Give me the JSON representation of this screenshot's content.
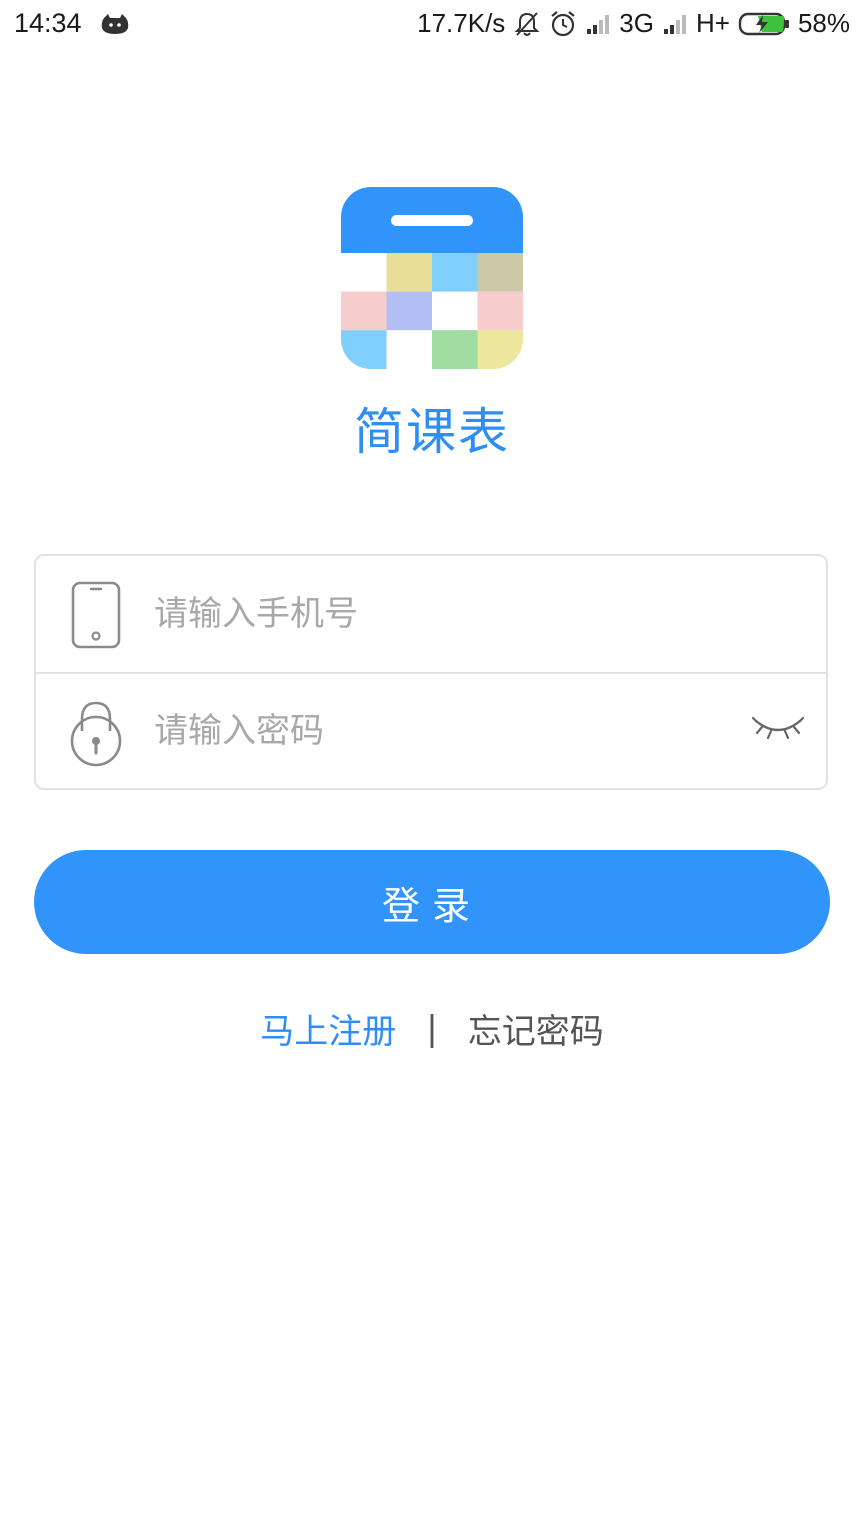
{
  "status_bar": {
    "time": "14:34",
    "network_speed": "17.7K/s",
    "network_3g": "3G",
    "network_hplus": "H+",
    "battery": "58%",
    "icons": [
      "android-cat-icon",
      "mute-bell-icon",
      "alarm-icon",
      "signal-icon",
      "signal-icon",
      "battery-charging-icon"
    ]
  },
  "logo": {
    "icon": "calendar-grid-icon",
    "app_name": "简课表",
    "colors": {
      "header": "#3094fb",
      "cells": [
        "#e9df9a",
        "#80cffd",
        "#ccc8a8",
        "#f6cccd",
        "#b3bef5",
        "#f6cccd",
        "#80cffd",
        "#a0dba1",
        "#ede79d"
      ]
    }
  },
  "form": {
    "phone_placeholder": "请输入手机号",
    "phone_value": "",
    "password_placeholder": "请输入密码",
    "password_value": "",
    "phone_icon": "phone-icon",
    "lock_icon": "lock-icon",
    "eye_icon": "eye-closed-icon"
  },
  "login_button": "登录",
  "links": {
    "register": "马上注册",
    "separator": "|",
    "forgot": "忘记密码"
  },
  "accent_color": "#3094fb"
}
